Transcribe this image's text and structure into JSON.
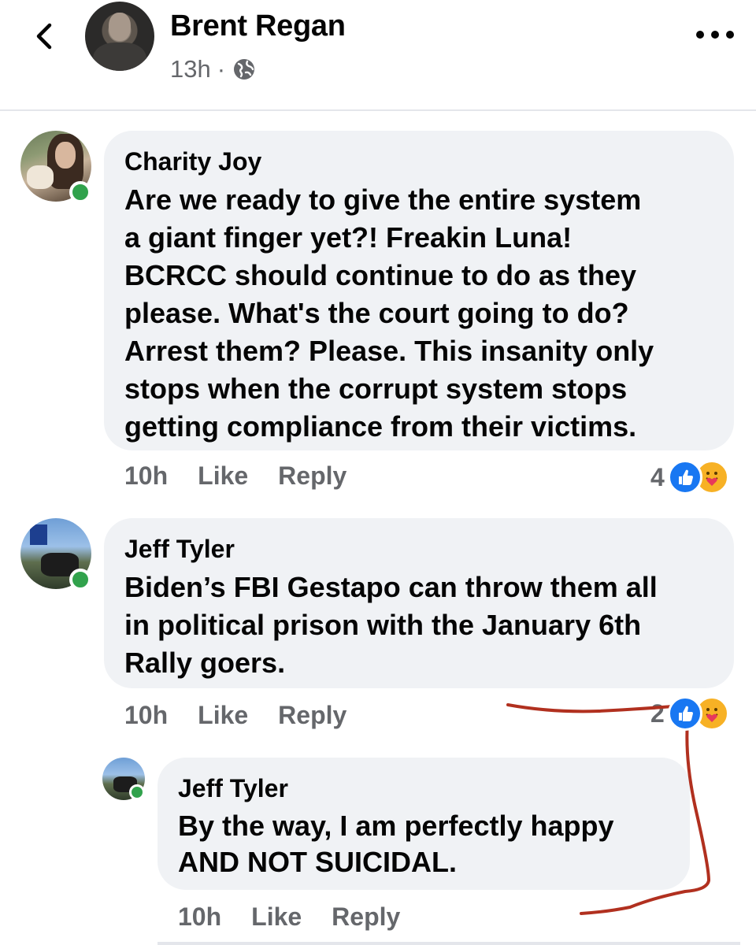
{
  "post": {
    "author": "Brent Regan",
    "time": "13h",
    "separator": "·",
    "icons": {
      "back": "chevron-left-icon",
      "privacy": "globe-icon",
      "more": "more-horizontal-icon"
    }
  },
  "comments": [
    {
      "name": "Charity Joy",
      "text": "Are we ready to give the entire system\na giant finger yet?! Freakin Luna!\nBCRCC should continue to do as they\nplease. What's the court going to do?\nArrest them? Please. This insanity only\nstops when the corrupt system stops\ngetting compliance from their victims.",
      "time": "10h",
      "like_label": "Like",
      "reply_label": "Reply",
      "reaction_count": "4",
      "reactions": [
        "like-icon",
        "care-icon"
      ],
      "online": true
    },
    {
      "name": "Jeff Tyler",
      "text": "Biden’s FBI Gestapo can throw them all\nin political prison with the January 6th\nRally goers.",
      "time": "10h",
      "like_label": "Like",
      "reply_label": "Reply",
      "reaction_count": "2",
      "reactions": [
        "like-icon",
        "care-icon"
      ],
      "online": true
    },
    {
      "name": "Jeff Tyler",
      "text": "By the way, I am perfectly happy\nAND NOT SUICIDAL.",
      "time": "10h",
      "like_label": "Like",
      "reply_label": "Reply",
      "online": true,
      "is_reply": true
    }
  ],
  "colors": {
    "bubble": "#f0f2f5",
    "secondary_text": "#65676b",
    "like_blue": "#1877f2",
    "care_yellow": "#f7b125",
    "online_green": "#31a24c",
    "annotation_red": "#b1301f"
  }
}
